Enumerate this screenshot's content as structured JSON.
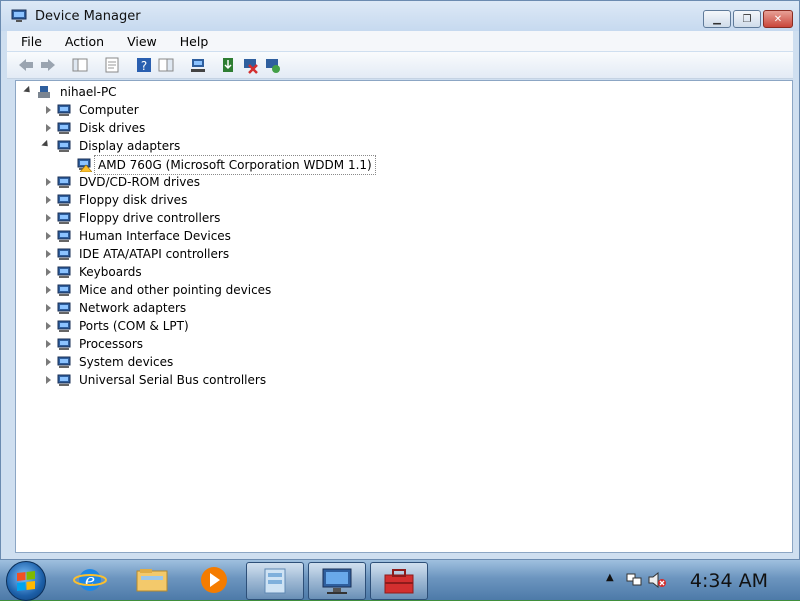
{
  "window": {
    "title": "Device Manager"
  },
  "menu": [
    "File",
    "Action",
    "View",
    "Help"
  ],
  "tree": {
    "root": "nihael-PC",
    "categories": [
      {
        "label": "Computer",
        "icon": "computer-icon"
      },
      {
        "label": "Disk drives",
        "icon": "disk-drive-icon"
      },
      {
        "label": "Display adapters",
        "icon": "display-adapter-icon",
        "expanded": true,
        "children": [
          {
            "label": "AMD 760G (Microsoft Corporation WDDM 1.1)",
            "icon": "display-adapter-warning-icon"
          }
        ]
      },
      {
        "label": "DVD/CD-ROM drives",
        "icon": "dvd-drive-icon"
      },
      {
        "label": "Floppy disk drives",
        "icon": "floppy-disk-icon"
      },
      {
        "label": "Floppy drive controllers",
        "icon": "floppy-controller-icon"
      },
      {
        "label": "Human Interface Devices",
        "icon": "hid-icon"
      },
      {
        "label": "IDE ATA/ATAPI controllers",
        "icon": "ide-controller-icon"
      },
      {
        "label": "Keyboards",
        "icon": "keyboard-icon"
      },
      {
        "label": "Mice and other pointing devices",
        "icon": "mouse-icon"
      },
      {
        "label": "Network adapters",
        "icon": "network-adapter-icon"
      },
      {
        "label": "Ports (COM & LPT)",
        "icon": "port-icon"
      },
      {
        "label": "Processors",
        "icon": "processor-icon"
      },
      {
        "label": "System devices",
        "icon": "system-devices-icon"
      },
      {
        "label": "Universal Serial Bus controllers",
        "icon": "usb-icon"
      }
    ]
  },
  "taskbar": {
    "clock": "4:34 AM",
    "pinned": [
      "internet-explorer-icon",
      "file-explorer-icon",
      "media-player-icon",
      "control-panel-icon",
      "device-manager-icon",
      "toolbox-icon"
    ]
  },
  "colors": {
    "titlebar": "#c6d9ef",
    "taskbar": "#6c95bf",
    "close": "#c9463a"
  }
}
